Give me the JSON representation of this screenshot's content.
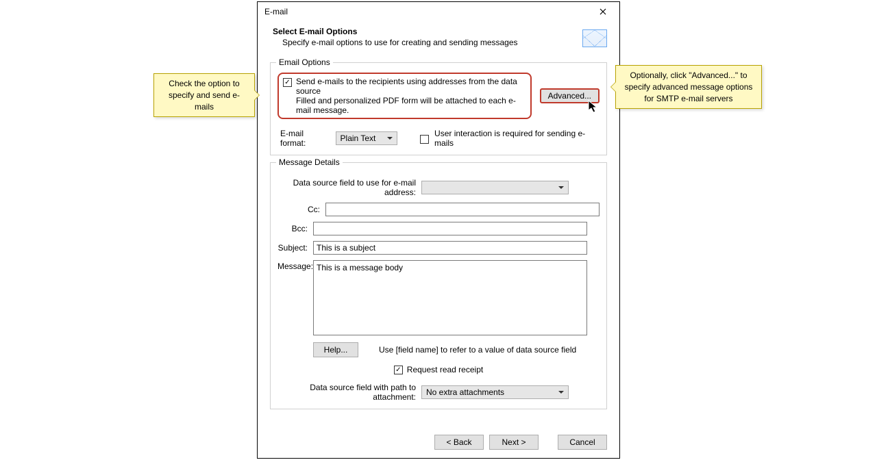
{
  "window": {
    "title": "E-mail"
  },
  "header": {
    "title": "Select E-mail Options",
    "subtitle": "Specify e-mail options to use for creating and sending messages"
  },
  "emailOptions": {
    "groupTitle": "Email Options",
    "sendLabel": "Send e-mails to the recipients using addresses from the data source",
    "sendSubLabel": "Filled and personalized PDF form will be attached to each e-mail message.",
    "advancedBtn": "Advanced...",
    "formatLabel": "E-mail format:",
    "formatValue": "Plain Text",
    "interactionLabel": "User interaction is required for sending e-mails"
  },
  "messageDetails": {
    "groupTitle": "Message Details",
    "dataFieldLabel": "Data source field to use for e-mail address:",
    "dataFieldValue": "",
    "ccLabel": "Cc:",
    "ccValue": "",
    "bccLabel": "Bcc:",
    "bccValue": "",
    "subjectLabel": "Subject:",
    "subjectValue": "This is a subject",
    "messageLabel": "Message:",
    "messageValue": "This is a message body",
    "helpBtn": "Help...",
    "helpHint": "Use [field name] to refer to a value of data source field",
    "receiptLabel": "Request read receipt",
    "attachLabel": "Data source field with path to attachment:",
    "attachValue": "No extra attachments"
  },
  "footer": {
    "back": "< Back",
    "next": "Next >",
    "cancel": "Cancel"
  },
  "callouts": {
    "left": "Check the option to specify and send e-mails",
    "right": "Optionally, click \"Advanced...\" to specify advanced message options for SMTP e-mail servers"
  }
}
